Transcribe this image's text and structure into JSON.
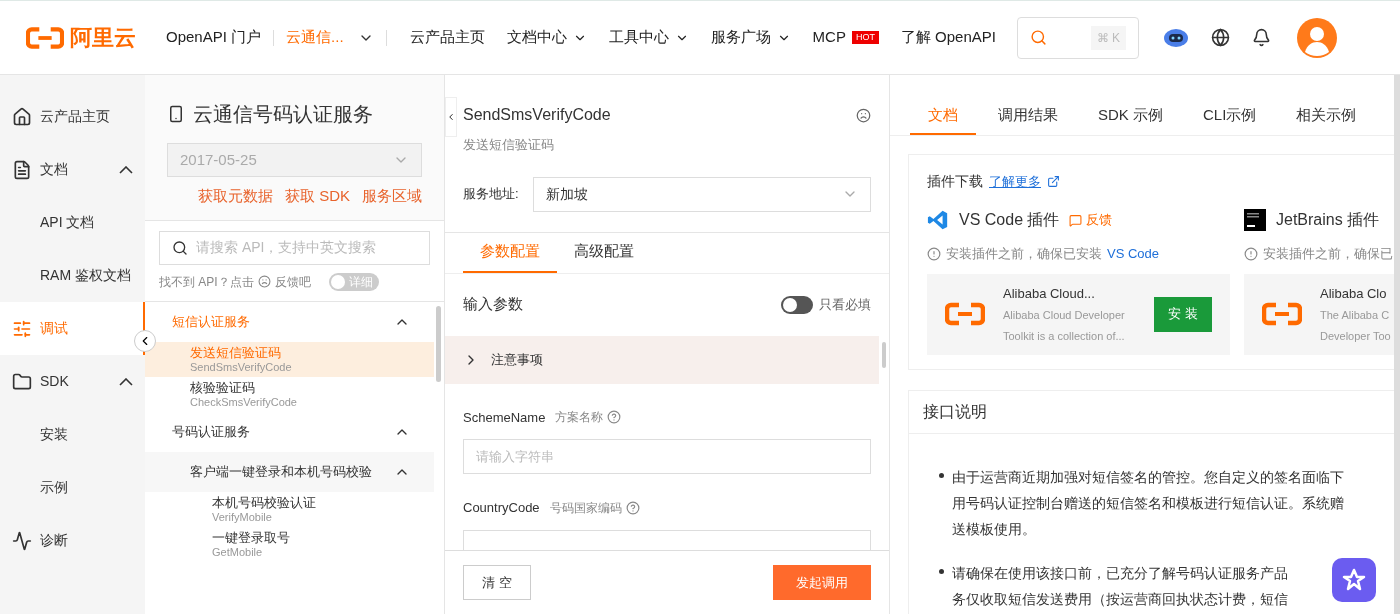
{
  "header": {
    "logo_text": "阿里云",
    "portal": "OpenAPI 门户",
    "product_switch": {
      "label": "云通信...",
      "selected": true
    },
    "nav": [
      {
        "label": "云产品主页",
        "dropdown": false
      },
      {
        "label": "文档中心",
        "dropdown": true
      },
      {
        "label": "工具中心",
        "dropdown": true
      },
      {
        "label": "服务广场",
        "dropdown": true
      },
      {
        "label": "MCP",
        "dropdown": false,
        "badge": "HOT"
      },
      {
        "label": "了解 OpenAPI",
        "dropdown": false
      }
    ],
    "search": {
      "shortcut": "⌘ K"
    }
  },
  "left_nav": [
    {
      "kind": "home",
      "label": "云产品主页",
      "selected": false
    },
    {
      "kind": "docs",
      "label": "文档",
      "expanded": true,
      "selected": false
    },
    {
      "kind": "child",
      "label": "API 文档",
      "selected": false
    },
    {
      "kind": "child",
      "label": "RAM 鉴权文档",
      "selected": false
    },
    {
      "kind": "debug",
      "label": "调试",
      "selected": true
    },
    {
      "kind": "sdk",
      "label": "SDK",
      "expanded": true,
      "selected": false
    },
    {
      "kind": "child",
      "label": "安装",
      "selected": false
    },
    {
      "kind": "child",
      "label": "示例",
      "selected": false
    },
    {
      "kind": "diagnose",
      "label": "诊断",
      "selected": false
    }
  ],
  "sidebar": {
    "title": "云通信号码认证服务",
    "version": "2017-05-25",
    "links": [
      "获取元数据",
      "获取 SDK",
      "服务区域"
    ],
    "search": {
      "placeholder": "请搜索 API，支持中英文搜索"
    },
    "help_before": "找不到 API？点击",
    "help_after": "反馈吧",
    "detail_toggle": {
      "label": "详细",
      "on": false
    },
    "tree": [
      {
        "label": "短信认证服务",
        "expanded": true,
        "children": [
          {
            "label": "发送短信验证码",
            "api": "SendSmsVerifyCode",
            "selected": true
          },
          {
            "label": "核验验证码",
            "api": "CheckSmsVerifyCode",
            "selected": false
          }
        ]
      },
      {
        "label": "号码认证服务",
        "expanded": true,
        "children": [
          {
            "label": "客户端一键登录和本机号码校验",
            "expanded": true,
            "children": [
              {
                "label": "本机号码校验认证",
                "api": "VerifyMobile",
                "selected": false
              },
              {
                "label": "一键登录取号",
                "api": "GetMobile",
                "selected": false
              }
            ]
          }
        ]
      }
    ]
  },
  "debug": {
    "api_name": "SendSmsVerifyCode",
    "api_title": "发送短信验证码",
    "endpoint": {
      "label": "服务地址:",
      "value": "新加坡"
    },
    "tabs": [
      {
        "label": "参数配置",
        "selected": true
      },
      {
        "label": "高级配置",
        "selected": false
      }
    ],
    "input_params": "输入参数",
    "required_only": {
      "label": "只看必填",
      "on": false
    },
    "notice": {
      "label": "注意事项",
      "expanded": false
    },
    "params": [
      {
        "name": "SchemeName",
        "desc": "方案名称",
        "placeholder": "请输入字符串"
      },
      {
        "name": "CountryCode",
        "desc": "号码国家编码"
      }
    ],
    "buttons": {
      "clear": "清 空",
      "invoke": "发起调用"
    }
  },
  "docs": {
    "tabs": [
      {
        "label": "文档",
        "selected": true
      },
      {
        "label": "调用结果",
        "selected": false
      },
      {
        "label": "SDK 示例",
        "selected": false
      },
      {
        "label": "CLI示例",
        "selected": false
      },
      {
        "label": "相关示例",
        "selected": false
      }
    ],
    "plugins": {
      "title": "插件下载",
      "learn_more": "了解更多",
      "items": [
        {
          "kind": "vscode",
          "name": "VS Code 插件",
          "feedback": "反馈",
          "note": "安装插件之前，确保已安装",
          "note_link": "VS Code",
          "card_title": "Alibaba Cloud...",
          "card_desc": [
            "Alibaba Cloud Developer",
            "Toolkit is a collection of..."
          ],
          "install": "安 装"
        },
        {
          "kind": "jetbrains",
          "name": "JetBrains 插件",
          "note": "安装插件之前，确保已",
          "card_title": "Alibaba Clo",
          "card_desc": [
            "The Alibaba C",
            "Developer Too"
          ]
        }
      ]
    },
    "description": {
      "title": "接口说明",
      "bullets": [
        [
          "由于运营商近期加强对短信签名的管控。您自定义的签名面临下",
          "用号码认证控制台赠送的短信签名和模板进行短信认证。系统赠",
          "送模板使用。"
        ],
        [
          "请确保在使用该接口前，已充分了解号码认证服务产品",
          "务仅收取短信发送费用（按运营商回执状态计费，短信"
        ]
      ]
    }
  }
}
